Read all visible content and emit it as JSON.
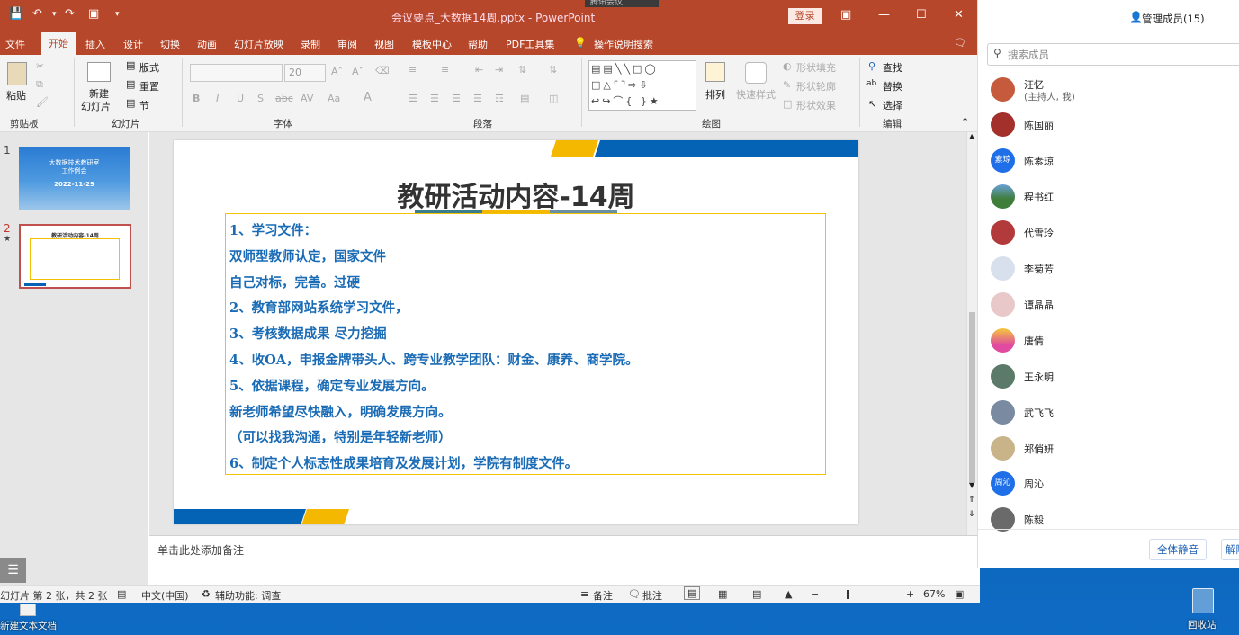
{
  "window": {
    "title": "会议要点_大数据14周.pptx - PowerPoint",
    "login": "登录",
    "meeting_tag": "腾讯会议"
  },
  "menu_tabs": [
    "文件",
    "开始",
    "插入",
    "设计",
    "切换",
    "动画",
    "幻灯片放映",
    "录制",
    "审阅",
    "视图",
    "模板中心",
    "帮助",
    "PDF工具集"
  ],
  "tell_me": "操作说明搜索",
  "ribbon": {
    "clipboard": {
      "paste": "粘贴",
      "label": "剪贴板"
    },
    "slides": {
      "new_slide_line1": "新建",
      "new_slide_line2": "幻灯片",
      "layout": "版式",
      "reset": "重置",
      "section": "节",
      "label": "幻灯片"
    },
    "font": {
      "size": "20",
      "label": "字体"
    },
    "paragraph": {
      "label": "段落"
    },
    "drawing": {
      "arrange": "排列",
      "quick_styles": "快速样式",
      "fill": "形状填充",
      "outline": "形状轮廓",
      "effects": "形状效果",
      "label": "绘图"
    },
    "editing": {
      "find": "查找",
      "replace": "替换",
      "select": "选择",
      "label": "编辑"
    }
  },
  "thumbnails": [
    {
      "number": "1",
      "title": "大数据技术教研室\n工作例会",
      "date": "2022-11-29"
    },
    {
      "number": "2",
      "title": "教研活动内容-14周"
    }
  ],
  "slide": {
    "title": "教研活动内容-14周",
    "lines": [
      "1、学习文件：",
      " 双师型教师认定，国家文件",
      " 自己对标，完善。过硬",
      "2、教育部网站系统学习文件，",
      "3、考核数据成果 尽力挖掘",
      "4、收OA，申报金牌带头人、跨专业教学团队：财金、康养、商学院。",
      "5、依据课程，确定专业发展方向。",
      "新老师希望尽快融入，明确发展方向。",
      "（可以找我沟通，特别是年轻新老师）",
      "6、制定个人标志性成果培育及发展计划，学院有制度文件。"
    ]
  },
  "notes_placeholder": "单击此处添加备注",
  "status": {
    "slide_info": "幻灯片 第 2 张，共 2 张",
    "language": "中文(中国)",
    "accessibility": "辅助功能: 调查",
    "notes": "备注",
    "comments": "批注",
    "zoom": "67%"
  },
  "panel": {
    "manage": "管理成员(15)",
    "search_placeholder": "搜索成员",
    "members": [
      {
        "name": "汪忆",
        "sub": "(主持人, 我)",
        "avatar": "photo",
        "color": "#c55a3c"
      },
      {
        "name": "陈国丽",
        "avatar": "photo",
        "color": "#a3302a"
      },
      {
        "name": "陈素琼",
        "avatar": "text",
        "avatar_text": "素琼",
        "color": "#1e6fe8"
      },
      {
        "name": "程书红",
        "avatar": "photo",
        "color": "#3e7d3a"
      },
      {
        "name": "代雪玲",
        "avatar": "photo",
        "color": "#b23a3a"
      },
      {
        "name": "李菊芳",
        "avatar": "photo",
        "color": "#8aa0c8"
      },
      {
        "name": "谭晶晶",
        "avatar": "photo",
        "color": "#d04a4a"
      },
      {
        "name": "唐倩",
        "avatar": "photo",
        "color": "#e04aa0"
      },
      {
        "name": "王永明",
        "avatar": "photo",
        "color": "#5b7a6a"
      },
      {
        "name": "武飞飞",
        "avatar": "photo",
        "color": "#7a8aa0"
      },
      {
        "name": "郑俏妍",
        "avatar": "photo",
        "color": "#c9b48a"
      },
      {
        "name": "周沁",
        "avatar": "text",
        "avatar_text": "周沁",
        "color": "#1e6fe8"
      },
      {
        "name": "陈毅",
        "avatar": "photo",
        "color": "#6a6a6a"
      }
    ],
    "mute_all": "全体静音",
    "unmute": "解除"
  },
  "desktop": {
    "new_doc": "新建文本文档",
    "recycle": "回收站"
  },
  "colors": {
    "ppt_red": "#b7472a",
    "slide_text": "#1a6bb5",
    "accent_blue": "#0563b5",
    "accent_yellow": "#f5b800"
  }
}
